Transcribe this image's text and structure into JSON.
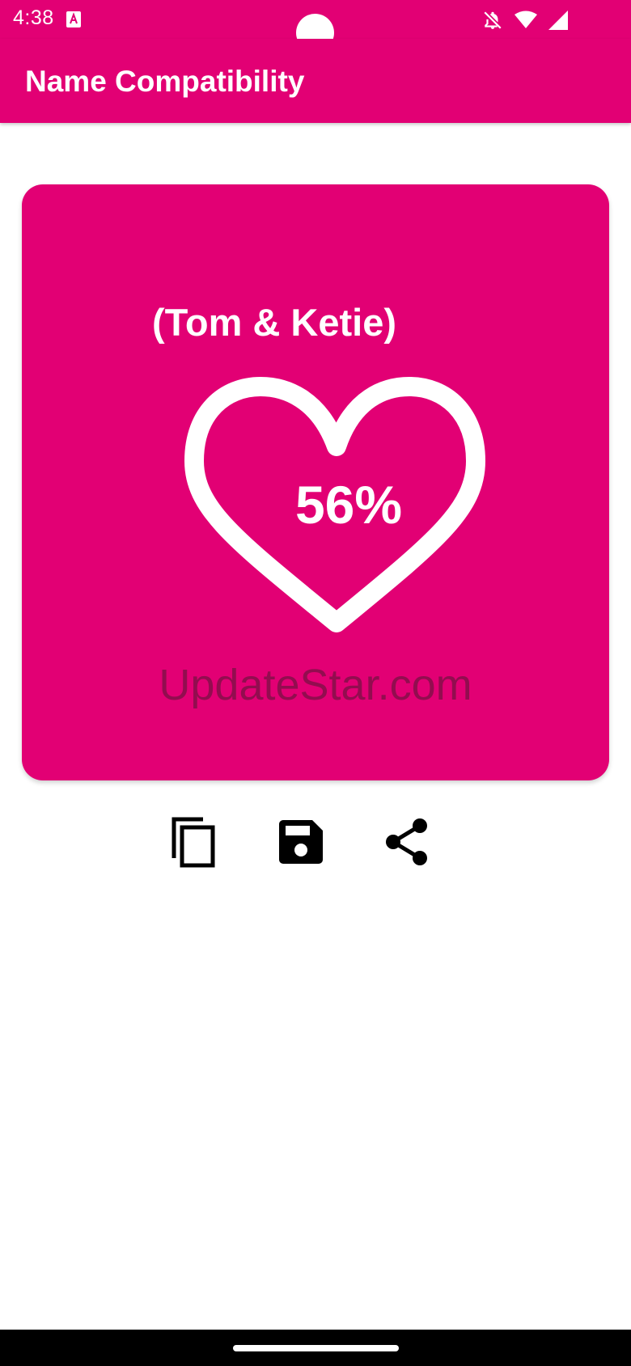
{
  "colors": {
    "brand": "#E20074",
    "on_brand": "#FFFFFF",
    "watermark": "#8A0F4C",
    "icon": "#000000"
  },
  "status_bar": {
    "time": "4:38",
    "app_icon": "text-a-icon",
    "icons": [
      "notifications-off-icon",
      "wifi-icon",
      "cell-signal-icon"
    ]
  },
  "app_bar": {
    "title": "Name Compatibility"
  },
  "result_card": {
    "names": "(Tom & Ketie)",
    "percent_label": "56%",
    "compatibility_percent": 56,
    "heart_icon": "heart-outline-icon",
    "watermark": "UpdateStar.com"
  },
  "actions": [
    {
      "name": "copy",
      "icon": "copy-icon"
    },
    {
      "name": "save",
      "icon": "save-icon"
    },
    {
      "name": "share",
      "icon": "share-icon"
    }
  ]
}
